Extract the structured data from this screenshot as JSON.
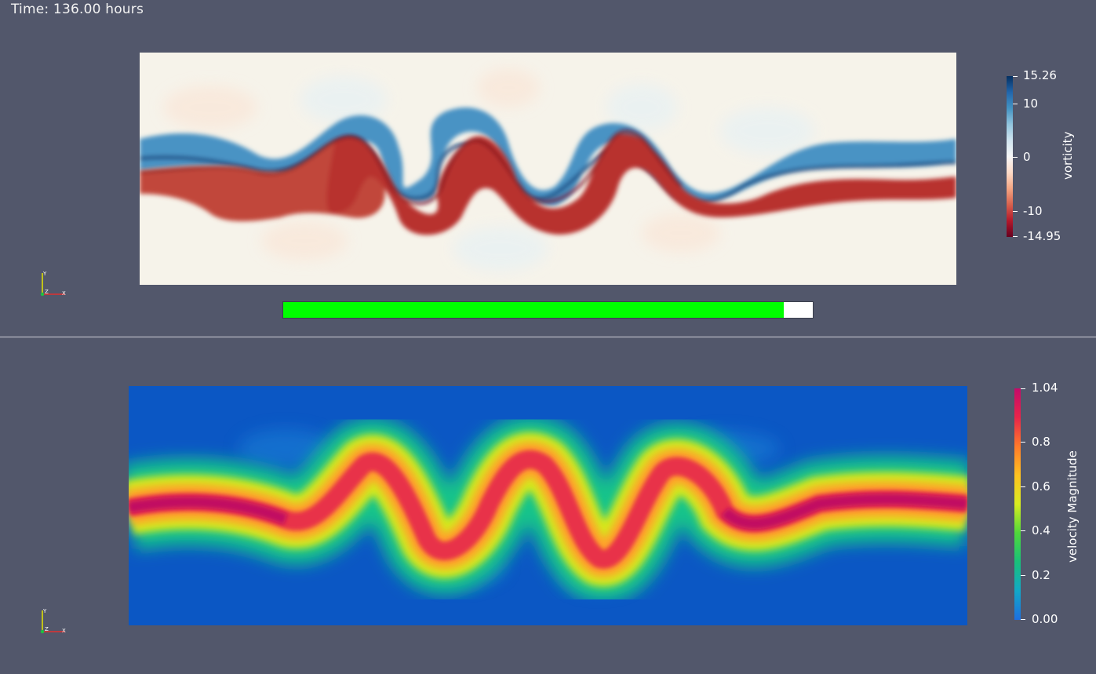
{
  "time_label": "Time: 136.00 hours",
  "top_view": {
    "colorbar": {
      "title": "vorticity",
      "max_label": "15.26",
      "min_label": "-14.95",
      "max": 15.26,
      "min": -14.95,
      "ticks": [
        "10",
        "0",
        "-10"
      ],
      "colormap": [
        "#67001f",
        "#b2182b",
        "#d6604d",
        "#f4a582",
        "#fddbc7",
        "#f7f7f7",
        "#d1e5f0",
        "#92c5de",
        "#4393c3",
        "#2166ac",
        "#053061"
      ]
    },
    "progress": {
      "fraction": 0.945
    },
    "axes": {
      "y": "Y",
      "z": "Z",
      "x": "X"
    }
  },
  "bottom_view": {
    "colorbar": {
      "title": "velocity Magnitude",
      "ticks": [
        "1.04",
        "0.8",
        "0.6",
        "0.4",
        "0.2",
        "0.00"
      ],
      "max": 1.04,
      "min": 0.0,
      "colormap": [
        "#1d6fe0",
        "#12a8c8",
        "#18c07a",
        "#4fd83a",
        "#d8ec20",
        "#ffc21f",
        "#ff7a2a",
        "#e8244a",
        "#c40a6a"
      ]
    },
    "axes": {
      "y": "Y",
      "z": "Z",
      "x": "X"
    }
  }
}
